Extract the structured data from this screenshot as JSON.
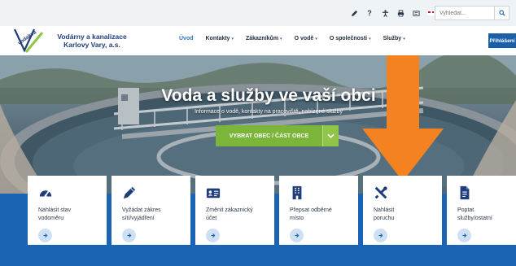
{
  "utility": {
    "icons": [
      "pen-icon",
      "help-icon",
      "accessibility-icon",
      "print-icon",
      "tree-icon",
      "flag-icon"
    ],
    "help_glyph": "?",
    "search_placeholder": "Vyhledat..."
  },
  "header": {
    "logo_text": "vodakva",
    "brand_line1": "Vodárny a kanalizace",
    "brand_line2": "Karlovy Vary, a.s.",
    "nav": [
      {
        "label": "Úvod",
        "active": true,
        "has_dropdown": false
      },
      {
        "label": "Kontakty",
        "active": false,
        "has_dropdown": true
      },
      {
        "label": "Zákazníkům",
        "active": false,
        "has_dropdown": true
      },
      {
        "label": "O vodě",
        "active": false,
        "has_dropdown": true
      },
      {
        "label": "O společnosti",
        "active": false,
        "has_dropdown": true
      },
      {
        "label": "Služby",
        "active": false,
        "has_dropdown": true
      }
    ],
    "login_label": "Přihlášení"
  },
  "hero": {
    "title": "Voda a služby ve vaší obci",
    "subtitle": "Informace o vodě, kontakty na pracoviště, nabízené služby",
    "select_button": "VYBRAT OBEC / ČÁST OBCE"
  },
  "cards": [
    {
      "icon": "gauge-icon",
      "line1": "Nahlásit stav",
      "line2": "vodoměru"
    },
    {
      "icon": "pencil-icon",
      "line1": "Vyžádat zákres",
      "line2": "sítí/vyjádření"
    },
    {
      "icon": "id-card-icon",
      "line1": "Změnit zákaznický",
      "line2": "účet"
    },
    {
      "icon": "building-icon",
      "line1": "Přepsat odběrné",
      "line2": "místo"
    },
    {
      "icon": "tools-icon",
      "line1": "Nahlásit",
      "line2": "poruchu"
    },
    {
      "icon": "document-icon",
      "line1": "Poptat",
      "line2": "služby/ostatní"
    }
  ],
  "colors": {
    "brand_blue": "#1b63b3",
    "nav_active": "#2e78c7",
    "accent_green": "#7bb53a",
    "annotation_orange": "#f58220"
  }
}
